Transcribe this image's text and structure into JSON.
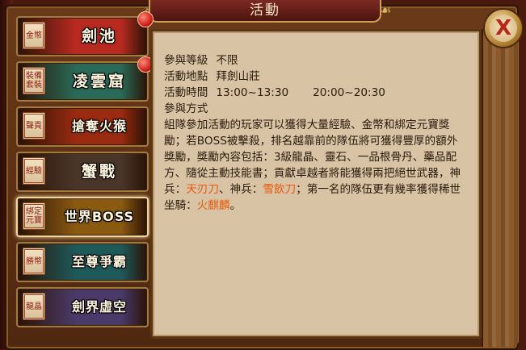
{
  "window": {
    "title": "活動",
    "close_symbol": "X",
    "title_ornaments": [
      "❧",
      "☙"
    ]
  },
  "sidebar": {
    "items": [
      {
        "badge": "金幣",
        "label": "劍池",
        "notify": true,
        "active": false,
        "bg": "#b82a20"
      },
      {
        "badge": "裝備套裝",
        "label": "凌雲窟",
        "notify": true,
        "active": false,
        "bg": "#2a6a58"
      },
      {
        "badge": "聲貢",
        "label": "搶奪火猴",
        "notify": false,
        "active": false,
        "bg": "#9a2a10"
      },
      {
        "badge": "經驗",
        "label": "蟹戰",
        "notify": false,
        "active": false,
        "bg": "#4a3628"
      },
      {
        "badge": "綁定元寶",
        "label": "世界BOSS",
        "notify": false,
        "active": true,
        "bg": "#8a5a10"
      },
      {
        "badge": "勝幣",
        "label": "至尊爭霸",
        "notify": false,
        "active": false,
        "bg": "#1e5a5a"
      },
      {
        "badge": "龍晶",
        "label": "劍界虛空",
        "notify": false,
        "active": false,
        "bg": "#4a3a6a"
      }
    ]
  },
  "details": {
    "level_label": "參與等級",
    "level_value": "不限",
    "location_label": "活動地點",
    "location_value": "拜劍山莊",
    "time_label": "活動時間",
    "time_value_1": "13:00~13:30",
    "time_value_2": "20:00~20:30",
    "method_label": "參與方式",
    "desc_part1": "組隊參加活動的玩家可以獲得大量經驗、金幣和綁定元寶獎勵；若BOSS被擊殺，排名越靠前的隊伍將可獲得豐厚的額外獎勵，獎勵內容包括：3級龍晶、靈石、一品根骨丹、藥品配方、隨從主動技能書；貢獻卓越者將能獲得兩把絕世武器，神兵：",
    "weapon_1": "天刃刀",
    "desc_part2": "、神兵：",
    "weapon_2": "雪飲刀",
    "desc_part3": "；第一名的隊伍更有幾率獲得稀世坐騎：",
    "mount": "火麒麟",
    "desc_end": "。"
  },
  "colors": {
    "highlight": "#e85a10",
    "panel_bg": "#d8c3a4",
    "text": "#2a1a0c"
  }
}
